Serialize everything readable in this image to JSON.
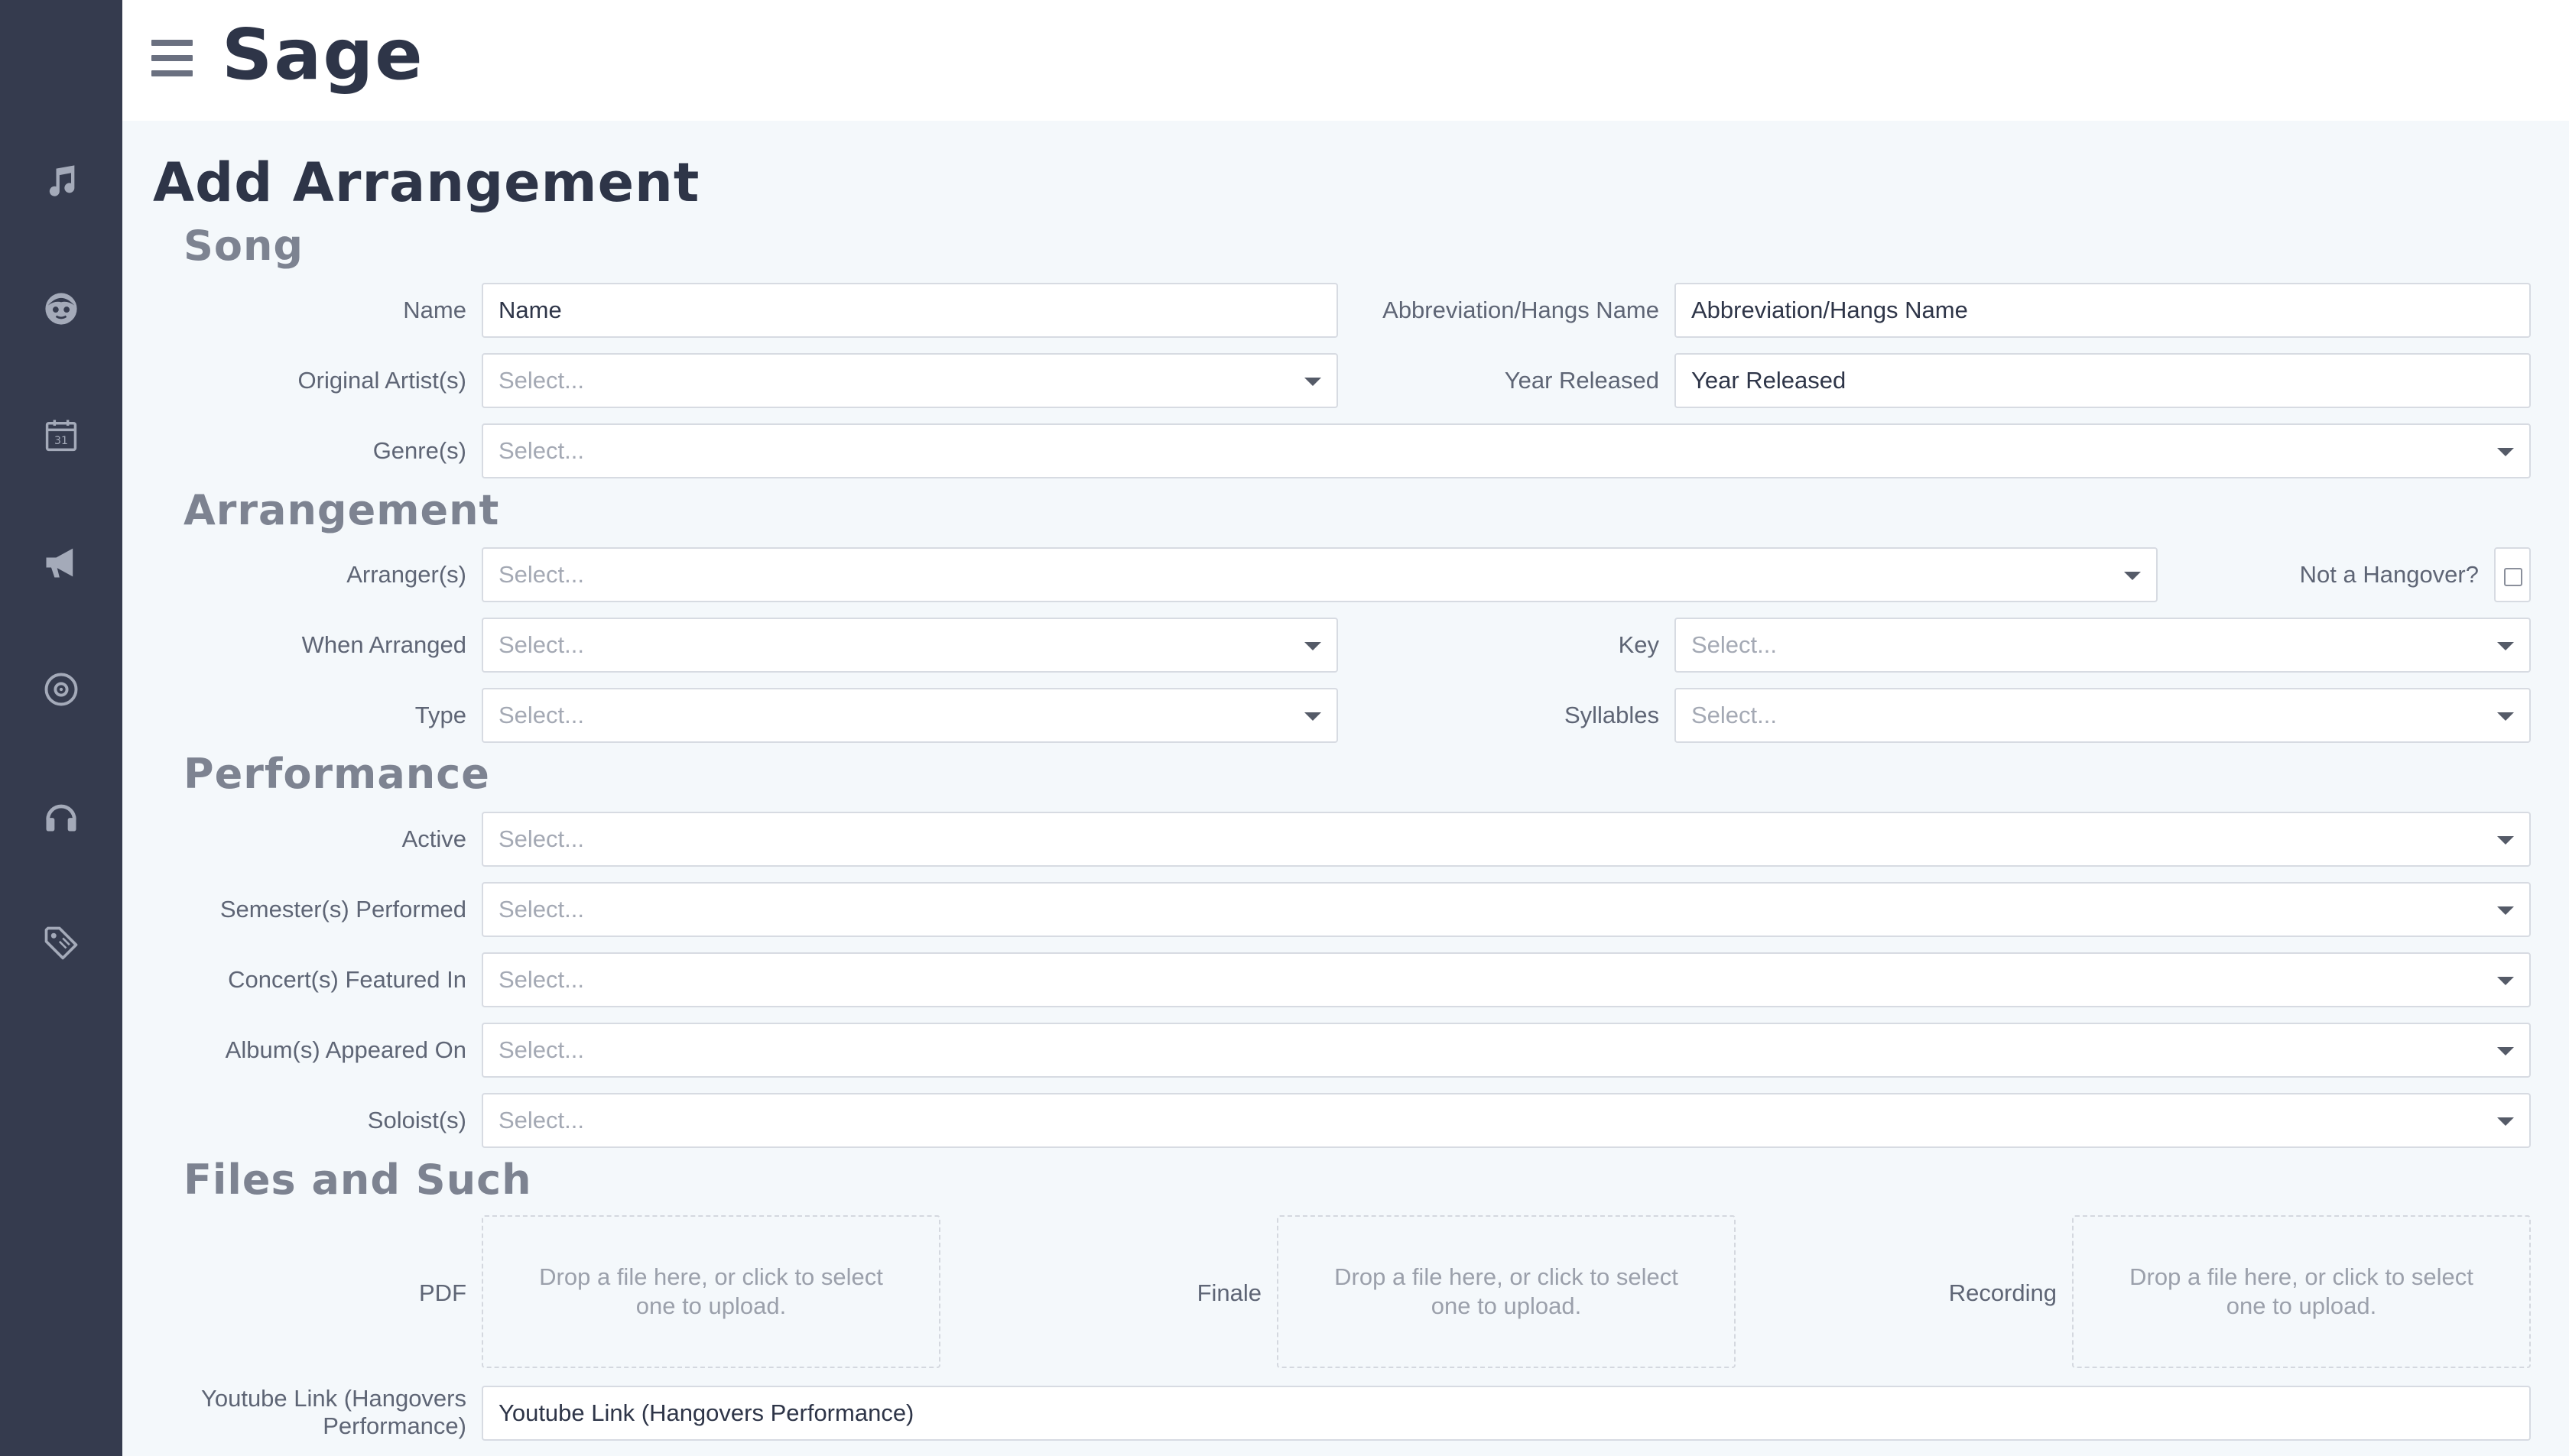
{
  "app": {
    "brand": "Sage"
  },
  "sidebar": {
    "icons": [
      "music-note-icon",
      "face-icon",
      "calendar-icon",
      "megaphone-icon",
      "disc-icon",
      "headphones-icon",
      "tag-icon"
    ],
    "calendar_day": "31"
  },
  "page": {
    "title": "Add Arrangement"
  },
  "sections": {
    "song": "Song",
    "arrangement": "Arrangement",
    "performance": "Performance",
    "files": "Files and Such"
  },
  "song": {
    "name_label": "Name",
    "name_placeholder": "Name",
    "abbrev_label": "Abbreviation/Hangs Name",
    "abbrev_placeholder": "Abbreviation/Hangs Name",
    "artists_label": "Original Artist(s)",
    "artists_value": "Select...",
    "year_label": "Year Released",
    "year_placeholder": "Year Released",
    "genres_label": "Genre(s)",
    "genres_value": "Select..."
  },
  "arrangement": {
    "arrangers_label": "Arranger(s)",
    "arrangers_value": "Select...",
    "not_hangover_label": "Not a Hangover?",
    "not_hangover_checked": false,
    "when_label": "When Arranged",
    "when_value": "Select...",
    "key_label": "Key",
    "key_value": "Select...",
    "type_label": "Type",
    "type_value": "Select...",
    "syllables_label": "Syllables",
    "syllables_value": "Select..."
  },
  "performance": {
    "active_label": "Active",
    "active_value": "Select...",
    "semesters_label": "Semester(s) Performed",
    "semesters_value": "Select...",
    "concerts_label": "Concert(s) Featured In",
    "concerts_value": "Select...",
    "albums_label": "Album(s) Appeared On",
    "albums_value": "Select...",
    "soloists_label": "Soloist(s)",
    "soloists_value": "Select..."
  },
  "files": {
    "pdf_label": "PDF",
    "finale_label": "Finale",
    "recording_label": "Recording",
    "drop_text": "Drop a file here, or click to select one to upload.",
    "youtube_label_line1": "Youtube Link (Hangovers",
    "youtube_label_line2": "Performance)",
    "youtube_placeholder": "Youtube Link (Hangovers Performance)"
  }
}
